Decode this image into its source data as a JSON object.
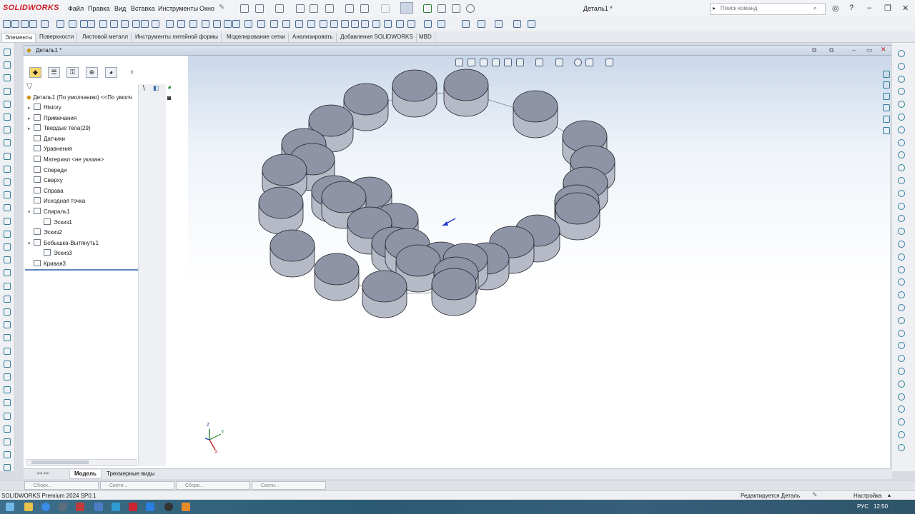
{
  "app": {
    "logo": "SOLIDWORKS",
    "document_title": "Деталь1 *"
  },
  "menu": [
    "Файл",
    "Правка",
    "Вид",
    "Вставка",
    "Инструменты",
    "Окно"
  ],
  "search": {
    "placeholder": "Поиск команд"
  },
  "command_tabs": [
    "Элементы",
    "Поверхности",
    "Листовой металл",
    "Инструменты литейной формы",
    "Моделирование сетки",
    "Анализировать",
    "Добавления SOLIDWORKS",
    "MBD"
  ],
  "active_command_tab": "Элементы",
  "document_tab": "Деталь1 *",
  "feature_tree": {
    "root": "Деталь1 (По умолчанию) <<По умолч",
    "items": [
      {
        "label": "History",
        "caret": "▸",
        "indent": 0,
        "icon": "history-icon"
      },
      {
        "label": "Примечания",
        "caret": "▸",
        "indent": 0,
        "icon": "annotations-icon"
      },
      {
        "label": "Твердые тела(29)",
        "caret": "▸",
        "indent": 0,
        "icon": "solid-bodies-icon"
      },
      {
        "label": "Датчики",
        "caret": "",
        "indent": 0,
        "icon": "sensors-icon"
      },
      {
        "label": "Уравнения",
        "caret": "",
        "indent": 0,
        "icon": "equations-icon"
      },
      {
        "label": "Материал <не указан>",
        "caret": "",
        "indent": 0,
        "icon": "material-icon"
      },
      {
        "label": "Спереди",
        "caret": "",
        "indent": 0,
        "icon": "plane-icon"
      },
      {
        "label": "Сверху",
        "caret": "",
        "indent": 0,
        "icon": "plane-icon"
      },
      {
        "label": "Справа",
        "caret": "",
        "indent": 0,
        "icon": "plane-icon"
      },
      {
        "label": "Исходная точка",
        "caret": "",
        "indent": 0,
        "icon": "origin-icon"
      },
      {
        "label": "Спираль1",
        "caret": "▾",
        "indent": 0,
        "icon": "helix-icon"
      },
      {
        "label": "Эскиз1",
        "caret": "",
        "indent": 1,
        "icon": "sketch-icon"
      },
      {
        "label": "Эскиз2",
        "caret": "",
        "indent": 0,
        "icon": "sketch-icon"
      },
      {
        "label": "Бобышка-Вытянуть1",
        "caret": "▾",
        "indent": 0,
        "icon": "extrude-icon"
      },
      {
        "label": "Эскиз3",
        "caret": "",
        "indent": 1,
        "icon": "sketch-icon"
      },
      {
        "label": "Кривая3",
        "caret": "",
        "indent": 0,
        "icon": "curve-icon"
      }
    ]
  },
  "bottom_tabs": [
    "Модель",
    "Трехмерные виды"
  ],
  "active_bottom_tab": "Модель",
  "mini_docs": [
    "Сборк...",
    "Свети...",
    "Сборк...",
    "Свети..."
  ],
  "status": {
    "version": "SOLIDWORKS Premium 2024 SP0.1",
    "editing": "Редактируется Деталь",
    "settings": "Настройка"
  },
  "tray": {
    "language": "РУС",
    "time": "12:50"
  },
  "triad": {
    "x": "X",
    "y": "Y",
    "z": "Z"
  },
  "colors": {
    "accent": "#d0202a",
    "body_fill": "#8e94a6",
    "body_side": "#b6bac6",
    "selection": "#5b86b8"
  }
}
